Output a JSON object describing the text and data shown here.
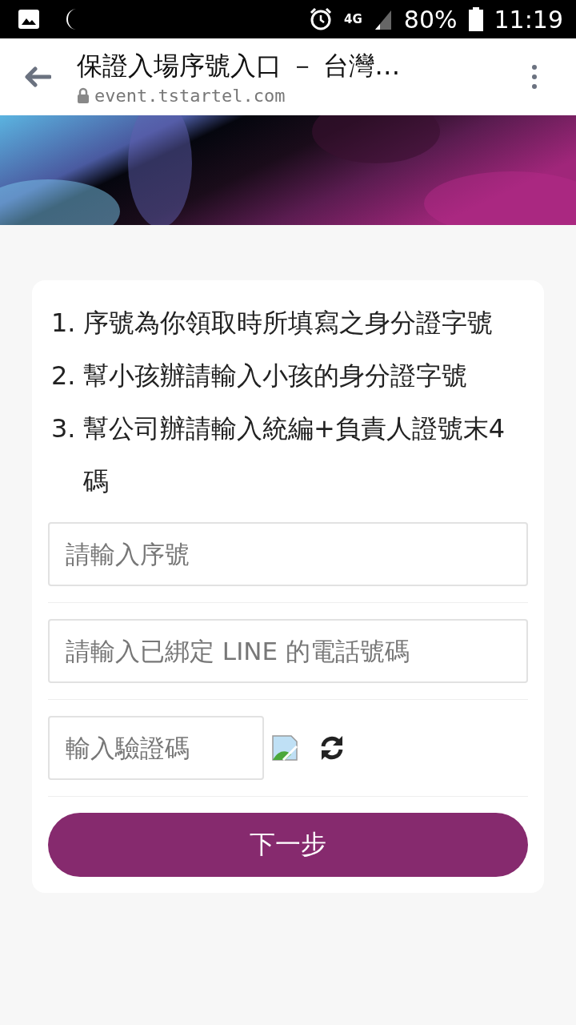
{
  "status_bar": {
    "battery": "80%",
    "time": "11:19",
    "network": "4G"
  },
  "browser": {
    "title": "保證入場序號入口 － 台灣…",
    "url": "event.tstartel.com"
  },
  "instructions": [
    {
      "number": "1.",
      "text": "序號為你領取時所填寫之身分證字號"
    },
    {
      "number": "2.",
      "text": "幫小孩辦請輸入小孩的身分證字號"
    },
    {
      "number": "3.",
      "text": "幫公司辦請輸入統編+負責人證號末4碼"
    }
  ],
  "serial_field": {
    "placeholder": "請輸入序號"
  },
  "phone_field": {
    "placeholder": "請輸入已綁定 LINE 的電話號碼"
  },
  "captcha_field": {
    "placeholder": "輸入驗證碼"
  },
  "next_button": {
    "label": "下一步"
  }
}
